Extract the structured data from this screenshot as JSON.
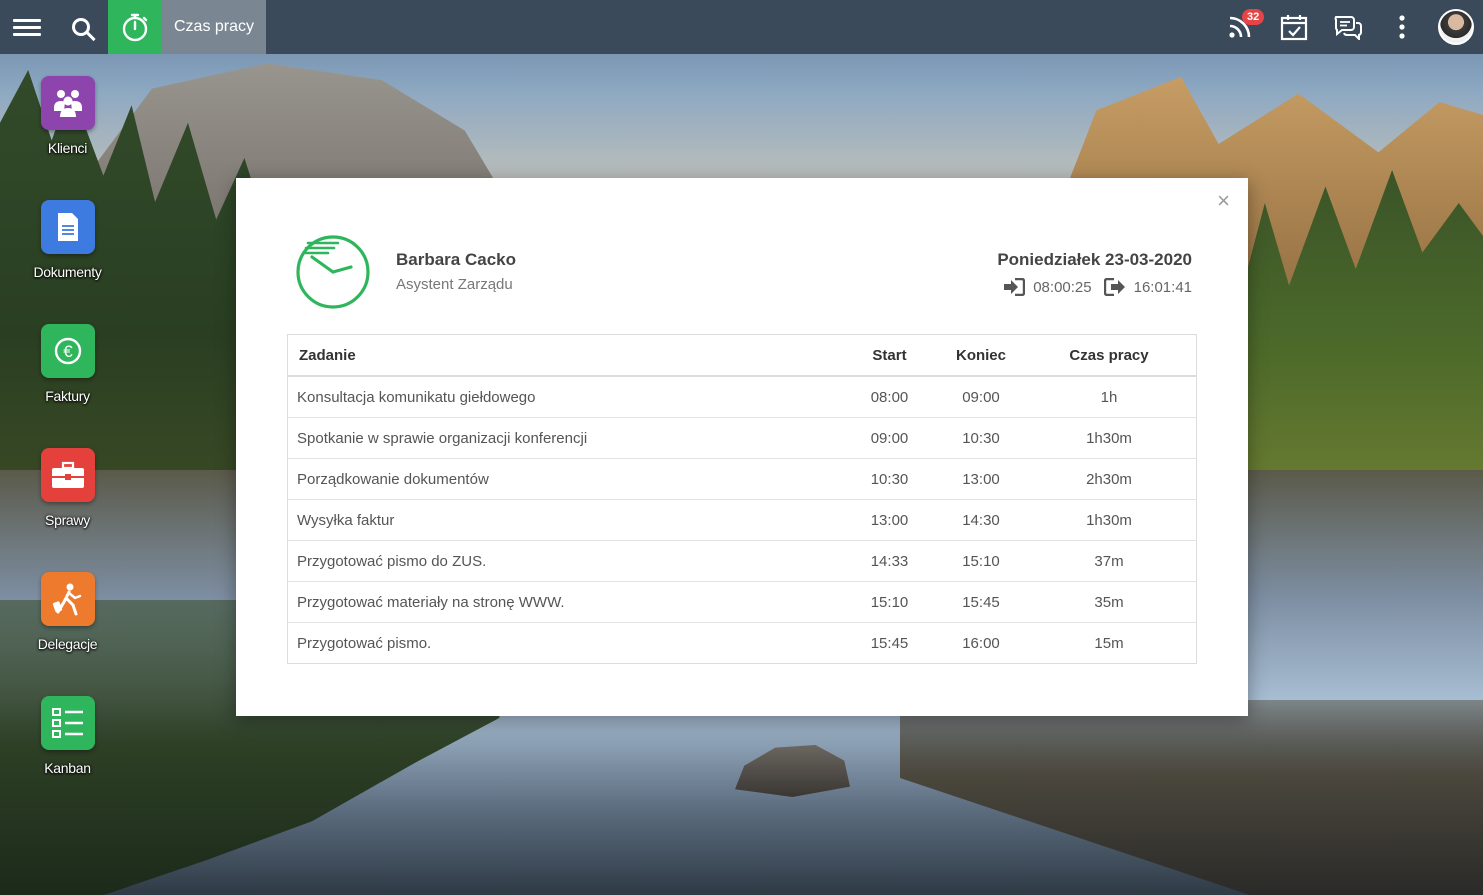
{
  "topbar": {
    "title": "Czas pracy",
    "notification_count": "32",
    "icons": [
      "menu-icon",
      "search-icon",
      "stopwatch-icon",
      "rss-icon",
      "calendar-check-icon",
      "chat-icon",
      "more-vertical-icon",
      "avatar"
    ]
  },
  "desktop": {
    "items": [
      {
        "label": "Klienci",
        "color": "#8e44ad",
        "icon": "people-icon"
      },
      {
        "label": "Dokumenty",
        "color": "#3d7be0",
        "icon": "document-icon"
      },
      {
        "label": "Faktury",
        "color": "#2fb65d",
        "icon": "euro-icon"
      },
      {
        "label": "Sprawy",
        "color": "#e5413c",
        "icon": "briefcase-icon"
      },
      {
        "label": "Delegacje",
        "color": "#ee7a2d",
        "icon": "traveler-icon"
      },
      {
        "label": "Kanban",
        "color": "#2fb65d",
        "icon": "kanban-icon"
      }
    ]
  },
  "modal": {
    "close": "×",
    "person": {
      "name": "Barbara Cacko",
      "role": "Asystent Zarządu"
    },
    "day": {
      "date": "Poniedziałek 23-03-2020",
      "login": "08:00:25",
      "logout": "16:01:41"
    },
    "table": {
      "headers": [
        "Zadanie",
        "Start",
        "Koniec",
        "Czas pracy"
      ],
      "rows": [
        [
          "Konsultacja komunikatu giełdowego",
          "08:00",
          "09:00",
          "1h"
        ],
        [
          "Spotkanie w sprawie organizacji konferencji",
          "09:00",
          "10:30",
          "1h30m"
        ],
        [
          "Porządkowanie dokumentów",
          "10:30",
          "13:00",
          "2h30m"
        ],
        [
          "Wysyłka faktur",
          "13:00",
          "14:30",
          "1h30m"
        ],
        [
          "Przygotować pismo do ZUS.",
          "14:33",
          "15:10",
          "37m"
        ],
        [
          "Przygotować materiały na stronę WWW.",
          "15:10",
          "15:45",
          "35m"
        ],
        [
          "Przygotować pismo.",
          "15:45",
          "16:00",
          "15m"
        ]
      ]
    },
    "accent": "#2fb65d"
  }
}
